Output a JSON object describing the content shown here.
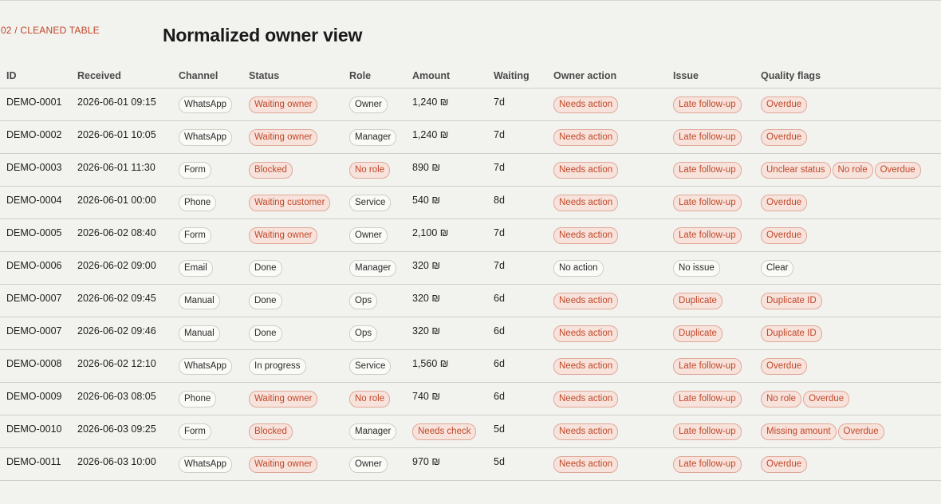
{
  "header": {
    "kicker": "02 / CLEANED TABLE",
    "title": "Normalized owner view"
  },
  "columns": [
    "ID",
    "Received",
    "Channel",
    "Status",
    "Role",
    "Amount",
    "Waiting",
    "Owner action",
    "Issue",
    "Quality flags"
  ],
  "rows": [
    {
      "id": "DEMO-0001",
      "received": "2026-06-01 09:15",
      "channel": "WhatsApp",
      "status": "Waiting owner",
      "status_warn": true,
      "role": "Owner",
      "role_warn": false,
      "amount": "1,240 ₪",
      "amount_warn": false,
      "waiting": "7d",
      "action": "Needs action",
      "action_warn": true,
      "issue": "Late follow-up",
      "issue_warn": true,
      "flags": [
        {
          "label": "Overdue",
          "warn": true
        }
      ]
    },
    {
      "id": "DEMO-0002",
      "received": "2026-06-01 10:05",
      "channel": "WhatsApp",
      "status": "Waiting owner",
      "status_warn": true,
      "role": "Manager",
      "role_warn": false,
      "amount": "1,240 ₪",
      "amount_warn": false,
      "waiting": "7d",
      "action": "Needs action",
      "action_warn": true,
      "issue": "Late follow-up",
      "issue_warn": true,
      "flags": [
        {
          "label": "Overdue",
          "warn": true
        }
      ]
    },
    {
      "id": "DEMO-0003",
      "received": "2026-06-01 11:30",
      "channel": "Form",
      "status": "Blocked",
      "status_warn": true,
      "role": "No role",
      "role_warn": true,
      "amount": "890 ₪",
      "amount_warn": false,
      "waiting": "7d",
      "action": "Needs action",
      "action_warn": true,
      "issue": "Late follow-up",
      "issue_warn": true,
      "flags": [
        {
          "label": "Unclear status",
          "warn": true
        },
        {
          "label": "No role",
          "warn": true
        },
        {
          "label": "Overdue",
          "warn": true
        }
      ]
    },
    {
      "id": "DEMO-0004",
      "received": "2026-06-01 00:00",
      "channel": "Phone",
      "status": "Waiting customer",
      "status_warn": true,
      "role": "Service",
      "role_warn": false,
      "amount": "540 ₪",
      "amount_warn": false,
      "waiting": "8d",
      "action": "Needs action",
      "action_warn": true,
      "issue": "Late follow-up",
      "issue_warn": true,
      "flags": [
        {
          "label": "Overdue",
          "warn": true
        }
      ]
    },
    {
      "id": "DEMO-0005",
      "received": "2026-06-02 08:40",
      "channel": "Form",
      "status": "Waiting owner",
      "status_warn": true,
      "role": "Owner",
      "role_warn": false,
      "amount": "2,100 ₪",
      "amount_warn": false,
      "waiting": "7d",
      "action": "Needs action",
      "action_warn": true,
      "issue": "Late follow-up",
      "issue_warn": true,
      "flags": [
        {
          "label": "Overdue",
          "warn": true
        }
      ]
    },
    {
      "id": "DEMO-0006",
      "received": "2026-06-02 09:00",
      "channel": "Email",
      "status": "Done",
      "status_warn": false,
      "role": "Manager",
      "role_warn": false,
      "amount": "320 ₪",
      "amount_warn": false,
      "waiting": "7d",
      "action": "No action",
      "action_warn": false,
      "issue": "No issue",
      "issue_warn": false,
      "flags": [
        {
          "label": "Clear",
          "warn": false
        }
      ]
    },
    {
      "id": "DEMO-0007",
      "received": "2026-06-02 09:45",
      "channel": "Manual",
      "status": "Done",
      "status_warn": false,
      "role": "Ops",
      "role_warn": false,
      "amount": "320 ₪",
      "amount_warn": false,
      "waiting": "6d",
      "action": "Needs action",
      "action_warn": true,
      "issue": "Duplicate",
      "issue_warn": true,
      "flags": [
        {
          "label": "Duplicate ID",
          "warn": true
        }
      ]
    },
    {
      "id": "DEMO-0007",
      "received": "2026-06-02 09:46",
      "channel": "Manual",
      "status": "Done",
      "status_warn": false,
      "role": "Ops",
      "role_warn": false,
      "amount": "320 ₪",
      "amount_warn": false,
      "waiting": "6d",
      "action": "Needs action",
      "action_warn": true,
      "issue": "Duplicate",
      "issue_warn": true,
      "flags": [
        {
          "label": "Duplicate ID",
          "warn": true
        }
      ]
    },
    {
      "id": "DEMO-0008",
      "received": "2026-06-02 12:10",
      "channel": "WhatsApp",
      "status": "In progress",
      "status_warn": false,
      "role": "Service",
      "role_warn": false,
      "amount": "1,560 ₪",
      "amount_warn": false,
      "waiting": "6d",
      "action": "Needs action",
      "action_warn": true,
      "issue": "Late follow-up",
      "issue_warn": true,
      "flags": [
        {
          "label": "Overdue",
          "warn": true
        }
      ]
    },
    {
      "id": "DEMO-0009",
      "received": "2026-06-03 08:05",
      "channel": "Phone",
      "status": "Waiting owner",
      "status_warn": true,
      "role": "No role",
      "role_warn": true,
      "amount": "740 ₪",
      "amount_warn": false,
      "waiting": "6d",
      "action": "Needs action",
      "action_warn": true,
      "issue": "Late follow-up",
      "issue_warn": true,
      "flags": [
        {
          "label": "No role",
          "warn": true
        },
        {
          "label": "Overdue",
          "warn": true
        }
      ]
    },
    {
      "id": "DEMO-0010",
      "received": "2026-06-03 09:25",
      "channel": "Form",
      "status": "Blocked",
      "status_warn": true,
      "role": "Manager",
      "role_warn": false,
      "amount": "Needs check",
      "amount_warn": true,
      "waiting": "5d",
      "action": "Needs action",
      "action_warn": true,
      "issue": "Late follow-up",
      "issue_warn": true,
      "flags": [
        {
          "label": "Missing amount",
          "warn": true
        },
        {
          "label": "Overdue",
          "warn": true
        }
      ]
    },
    {
      "id": "DEMO-0011",
      "received": "2026-06-03 10:00",
      "channel": "WhatsApp",
      "status": "Waiting owner",
      "status_warn": true,
      "role": "Owner",
      "role_warn": false,
      "amount": "970 ₪",
      "amount_warn": false,
      "waiting": "5d",
      "action": "Needs action",
      "action_warn": true,
      "issue": "Late follow-up",
      "issue_warn": true,
      "flags": [
        {
          "label": "Overdue",
          "warn": true
        }
      ]
    }
  ],
  "colors": {
    "accent": "#c0472a",
    "warn_bg": "#f7e3db",
    "background": "#f2f2ee"
  }
}
